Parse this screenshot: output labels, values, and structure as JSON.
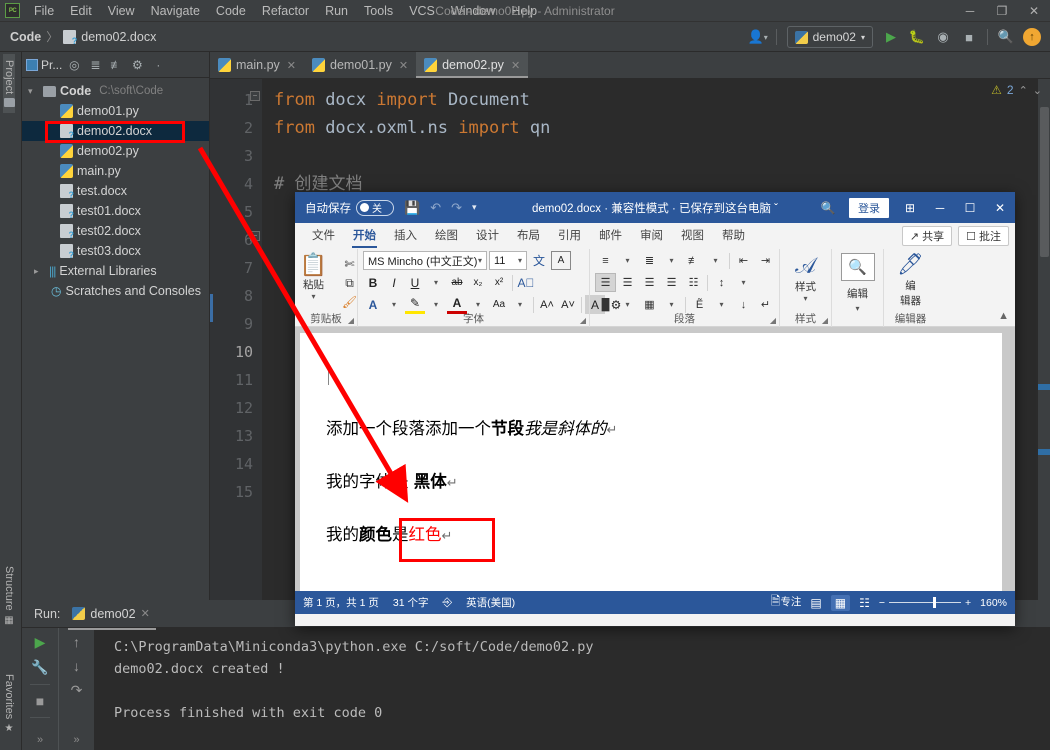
{
  "ide": {
    "window_title": "Code - demo02.py - Administrator",
    "logo": "pycharm-logo",
    "menu": [
      "File",
      "Edit",
      "View",
      "Navigate",
      "Code",
      "Refactor",
      "Run",
      "Tools",
      "VCS",
      "Window",
      "Help"
    ],
    "window_controls": {
      "minimize": "─",
      "maximize": "❐",
      "close": "✕"
    },
    "breadcrumb": {
      "project": "Code",
      "separator": "〉",
      "file": "demo02.docx"
    },
    "toolbar": {
      "user_icon": "user-icon",
      "run_config": "demo02",
      "run": "run-icon",
      "debug": "debug-icon",
      "coverage": "coverage-icon",
      "stop": "stop-icon",
      "search": "search-icon",
      "update_badge": "↑"
    },
    "left_strip": {
      "project": "Project",
      "structure": "Structure",
      "favorites": "Favorites"
    },
    "project_panel": {
      "title": "Pr...",
      "icons": [
        "target-icon",
        "collapse-icon",
        "expand-icon",
        "gear-icon",
        "more-icon"
      ],
      "root": {
        "label": "Code",
        "path": "C:\\soft\\Code"
      },
      "files": [
        {
          "name": "demo01.py",
          "type": "py",
          "selected": false
        },
        {
          "name": "demo02.docx",
          "type": "docx",
          "selected": true
        },
        {
          "name": "demo02.py",
          "type": "py",
          "selected": false
        },
        {
          "name": "main.py",
          "type": "py",
          "selected": false
        },
        {
          "name": "test.docx",
          "type": "docx",
          "selected": false
        },
        {
          "name": "test01.docx",
          "type": "docx",
          "selected": false
        },
        {
          "name": "test02.docx",
          "type": "docx",
          "selected": false
        },
        {
          "name": "test03.docx",
          "type": "docx",
          "selected": false
        }
      ],
      "external_libraries": "External Libraries",
      "scratches": "Scratches and Consoles"
    },
    "editor": {
      "tabs": [
        {
          "label": "main.py",
          "active": false
        },
        {
          "label": "demo01.py",
          "active": false
        },
        {
          "label": "demo02.py",
          "active": true
        }
      ],
      "close_glyph": "✕",
      "warnings": {
        "icon": "warning-triangle-icon",
        "count": "2",
        "up": "⌃",
        "down": "⌄"
      },
      "line_numbers": [
        "1",
        "2",
        "3",
        "4",
        "5",
        "6",
        "7",
        "8",
        "9",
        "10",
        "11",
        "12",
        "13",
        "14",
        "15"
      ],
      "current_line": "10",
      "lines": [
        {
          "n": 1,
          "tokens": [
            {
              "t": "from ",
              "c": "kw"
            },
            {
              "t": "docx ",
              "c": "id"
            },
            {
              "t": "import ",
              "c": "kw"
            },
            {
              "t": "Document",
              "c": "id"
            }
          ]
        },
        {
          "n": 2,
          "tokens": [
            {
              "t": "from ",
              "c": "kw"
            },
            {
              "t": "docx.oxml.ns ",
              "c": "id"
            },
            {
              "t": "import ",
              "c": "kw"
            },
            {
              "t": "qn",
              "c": "id"
            }
          ]
        },
        {
          "n": 3,
          "tokens": []
        },
        {
          "n": 4,
          "tokens": [
            {
              "t": "# 创建文档",
              "c": "cm"
            }
          ]
        }
      ]
    },
    "run_panel": {
      "label": "Run:",
      "tab": "demo02",
      "close_glyph": "✕",
      "gutter_icons": [
        "rerun-icon",
        "wrench-icon",
        "stop-icon",
        "up-icon",
        "down-icon",
        "soft-wrap-icon"
      ],
      "more_glyph": "»",
      "console": [
        "C:\\ProgramData\\Miniconda3\\python.exe C:/soft/Code/demo02.py",
        "demo02.docx created !",
        "",
        "Process finished with exit code 0"
      ]
    }
  },
  "word": {
    "titlebar": {
      "autosave_label": "自动保存",
      "autosave_state": "关",
      "save_icon": "save-icon",
      "undo_icon": "undo-icon",
      "redo_icon": "redo-icon",
      "customize_icon": "chevron-down-icon",
      "doc_title": "demo02.docx  ·  兼容性模式  ·  已保存到这台电脑  ˇ",
      "search_icon": "search-icon",
      "signin": "登录",
      "ribbon_display_icon": "ribbon-display-icon",
      "minimize": "─",
      "maximize": "☐",
      "close": "✕"
    },
    "ribbon_tabs": [
      {
        "label": "文件",
        "active": false
      },
      {
        "label": "开始",
        "active": true
      },
      {
        "label": "插入",
        "active": false
      },
      {
        "label": "绘图",
        "active": false
      },
      {
        "label": "设计",
        "active": false
      },
      {
        "label": "布局",
        "active": false
      },
      {
        "label": "引用",
        "active": false
      },
      {
        "label": "邮件",
        "active": false
      },
      {
        "label": "审阅",
        "active": false
      },
      {
        "label": "视图",
        "active": false
      },
      {
        "label": "帮助",
        "active": false
      }
    ],
    "ribbon_right": [
      {
        "label": "共享",
        "icon": "share-icon"
      },
      {
        "label": "批注",
        "icon": "comment-icon"
      }
    ],
    "groups": {
      "clipboard": {
        "name": "剪贴板",
        "paste": "粘贴",
        "cut_icon": "scissors-icon",
        "copy_icon": "copy-icon",
        "format_painter_icon": "format-painter-icon"
      },
      "font": {
        "name": "字体",
        "font_name": "MS Mincho (中文正文)",
        "font_size": "11",
        "bold": "B",
        "italic": "I",
        "underline": "U",
        "strike": "ab",
        "subscript": "x₂",
        "superscript": "x²",
        "clear_format_icon": "clear-format-icon",
        "text_effects_icon": "text-effects-icon",
        "highlight_icon": "highlight-icon",
        "font_color_icon": "font-color-icon",
        "change_case": "Aa",
        "grow_font": "A˄",
        "shrink_font": "A˅",
        "phonetic_icon": "phonetic-icon",
        "enclose_icon": "enclose-icon",
        "char_border_icon": "character-border-icon"
      },
      "paragraph": {
        "name": "段落",
        "bullets_icon": "bullets-icon",
        "numbering_icon": "numbering-icon",
        "multilevel_icon": "multilevel-list-icon",
        "decrease_indent_icon": "decrease-indent-icon",
        "increase_indent_icon": "increase-indent-icon",
        "align_left_icon": "align-left-icon",
        "align_center_icon": "align-center-icon",
        "align_right_icon": "align-right-icon",
        "justify_icon": "justify-icon",
        "distribute_icon": "distribute-icon",
        "line_spacing_icon": "line-spacing-icon",
        "shading_icon": "shading-icon",
        "borders_icon": "borders-icon",
        "phonetic_guide_icon": "phonetic-guide-icon",
        "sort_icon": "sort-icon",
        "show_marks_icon": "show-formatting-marks-icon"
      },
      "styles": {
        "name": "样式",
        "label": "样式"
      },
      "editing": {
        "label": "编辑",
        "icon": "search-icon"
      },
      "editor": {
        "name": "编辑器",
        "label_line1": "编",
        "label_line2": "辑器",
        "icon": "editor-pen-icon"
      }
    },
    "document": {
      "paragraphs": [
        {
          "runs": [
            {
              "text": "添加一个段落添加一个",
              "style": "normal"
            },
            {
              "text": "节段",
              "style": "bold"
            },
            {
              "text": "我是斜体的",
              "style": "italic"
            },
            {
              "text": "↵",
              "style": "mark"
            }
          ]
        },
        {
          "runs": [
            {
              "text": "我的字体是 ",
              "style": "normal"
            },
            {
              "text": "黑体",
              "style": "bold"
            },
            {
              "text": "↵",
              "style": "mark"
            }
          ]
        },
        {
          "runs": [
            {
              "text": "我的",
              "style": "normal"
            },
            {
              "text": "颜色",
              "style": "bold"
            },
            {
              "text": "是",
              "style": "normal"
            },
            {
              "text": "红色",
              "style": "red"
            },
            {
              "text": "↵",
              "style": "mark"
            }
          ]
        }
      ]
    },
    "statusbar": {
      "page": "第 1 页，共 1 页",
      "words": "31 个字",
      "proofing_icon": "proofing-icon",
      "language": "英语(美国)",
      "focus": "专注",
      "focus_icon": "focus-icon",
      "read_mode_icon": "read-mode-icon",
      "print_layout_icon": "print-layout-icon",
      "web_layout_icon": "web-layout-icon",
      "zoom_out": "−",
      "zoom_in": "+",
      "zoom_level": "160%"
    }
  },
  "annotations": {
    "highlight_tree_item": "demo02.docx",
    "highlight_doc_text": "是红色",
    "arrow_color": "#ff0000"
  }
}
